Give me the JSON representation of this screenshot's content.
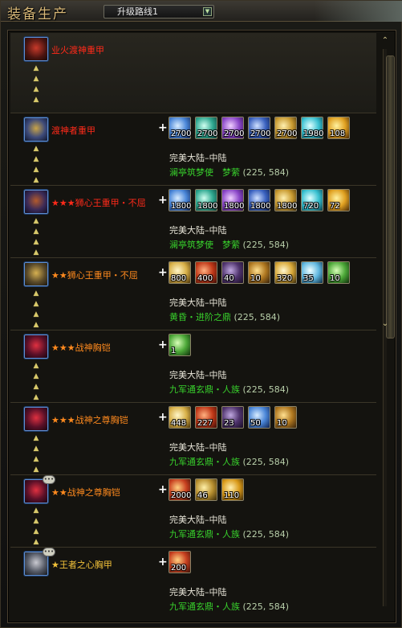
{
  "window": {
    "title": "装备生产"
  },
  "route_select": {
    "value": "升级路线1"
  },
  "colors": {
    "red": "#ff2a1a",
    "orange": "#ff8a1e",
    "gold": "#f2c23a",
    "npc_green": "#38d02c"
  },
  "entries": [
    {
      "name": "业火渡神重甲",
      "name_color": "#ff2a1a",
      "portrait": "red-armor-icon",
      "materials": [],
      "region": "",
      "npc": "",
      "coords": ""
    },
    {
      "name": "渡神者重甲",
      "name_color": "#ff2a1a",
      "portrait": "blue-gold-armor-icon",
      "materials": [
        {
          "icon": "blue-sphere-icon",
          "count": "2700"
        },
        {
          "icon": "teal-orb-icon",
          "count": "2700"
        },
        {
          "icon": "purple-gem-icon",
          "count": "2700"
        },
        {
          "icon": "blue-crystal-icon",
          "count": "2700"
        },
        {
          "icon": "gold-relic-icon",
          "count": "2700"
        },
        {
          "icon": "cyan-flower-icon",
          "count": "1980"
        },
        {
          "icon": "golden-flame-icon",
          "count": "108"
        }
      ],
      "region": "完美大陆–中陆",
      "npc": "澜亭筑梦使　梦萦",
      "coords": "(225, 584)"
    },
    {
      "name": "★★★狮心王重甲・不屈",
      "name_color": "#ff2a1a",
      "portrait": "lion-armor-icon",
      "materials": [
        {
          "icon": "blue-sphere-icon",
          "count": "1800"
        },
        {
          "icon": "teal-orb-icon",
          "count": "1800"
        },
        {
          "icon": "purple-gem-icon",
          "count": "1800"
        },
        {
          "icon": "blue-crystal-icon",
          "count": "1800"
        },
        {
          "icon": "gold-relic-icon",
          "count": "1800"
        },
        {
          "icon": "cyan-flower-icon",
          "count": "720"
        },
        {
          "icon": "golden-flame-icon",
          "count": "72"
        }
      ],
      "region": "完美大陆–中陆",
      "npc": "澜亭筑梦使　梦萦",
      "coords": "(225, 584)"
    },
    {
      "name": "★★狮心王重甲・不屈",
      "name_color": "#ff8a1e",
      "portrait": "lion-armor-gold-icon",
      "materials": [
        {
          "icon": "yellow-scroll-icon",
          "count": "800"
        },
        {
          "icon": "red-flame-icon",
          "count": "400"
        },
        {
          "icon": "dark-wing-icon",
          "count": "40"
        },
        {
          "icon": "gold-pouch-icon",
          "count": "10"
        },
        {
          "icon": "moon-gold-icon",
          "count": "320"
        },
        {
          "icon": "ice-blade-icon",
          "count": "35"
        },
        {
          "icon": "green-beast-icon",
          "count": "10"
        }
      ],
      "region": "完美大陆–中陆",
      "npc": "黄昏・进阶之鼎",
      "coords": "(225, 584)"
    },
    {
      "name": "★★★战神胸铠",
      "name_color": "#ff8a1e",
      "portrait": "crimson-war-armor-icon",
      "materials": [
        {
          "icon": "green-beast-icon",
          "count": "1"
        }
      ],
      "region": "完美大陆–中陆",
      "npc": "九军通玄鼎・人族",
      "coords": "(225, 584)"
    },
    {
      "name": "★★★战神之尊胸铠",
      "name_color": "#ff8a1e",
      "portrait": "crimson-war-armor-icon",
      "materials": [
        {
          "icon": "yellow-scroll-icon",
          "count": "448"
        },
        {
          "icon": "red-flame-icon",
          "count": "227"
        },
        {
          "icon": "dark-wing-icon",
          "count": "23"
        },
        {
          "icon": "blue-sphere-icon",
          "count": "50"
        },
        {
          "icon": "gold-pouch-icon",
          "count": "10"
        }
      ],
      "region": "完美大陆–中陆",
      "npc": "九军通玄鼎・人族",
      "coords": "(225, 584)"
    },
    {
      "name": "★★战神之尊胸铠",
      "name_color": "#ff8a1e",
      "portrait": "crimson-war-armor-icon",
      "materials": [
        {
          "icon": "red-gold-pot-icon",
          "count": "2000"
        },
        {
          "icon": "gold-pillar-icon",
          "count": "46"
        },
        {
          "icon": "gold-gourd-icon",
          "count": "110"
        }
      ],
      "region": "完美大陆–中陆",
      "npc": "九军通玄鼎・人族",
      "coords": "(225, 584)"
    },
    {
      "name": "★王者之心胸甲",
      "name_color": "#f2c23a",
      "portrait": "silver-armor-icon",
      "materials": [
        {
          "icon": "red-gold-pot-icon",
          "count": "200"
        }
      ],
      "region": "完美大陆–中陆",
      "npc": "九军通玄鼎・人族",
      "coords": "(225, 584)"
    }
  ]
}
